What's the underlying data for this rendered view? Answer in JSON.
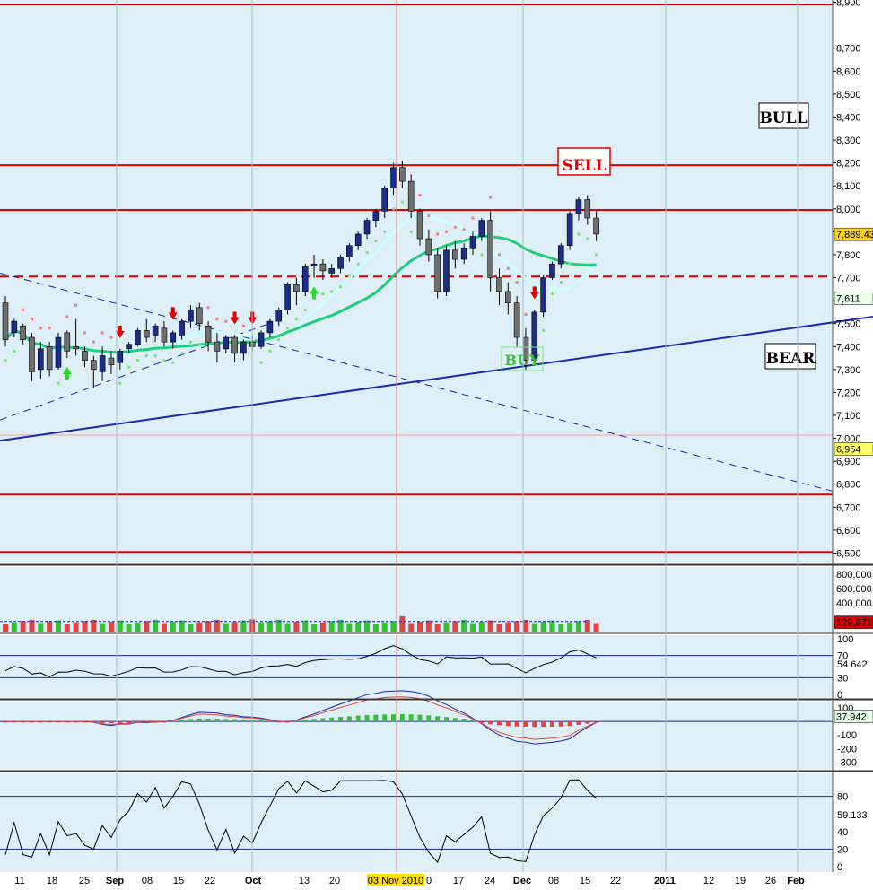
{
  "chart_data": {
    "type": "candlestick",
    "colors": {
      "background": "#dfeff7",
      "grid": "#a9bccb",
      "candle_up": "#1c2c8c",
      "candle_down": "#6f6f6f",
      "ma_green": "#1ecf7a",
      "ma_cyan": "#ccffff",
      "sar_red": "#f08080",
      "sar_green": "#7ee07e",
      "hline": "#e00000",
      "trend": "#1a2aa8",
      "vol_up": "#34c234",
      "vol_down": "#e04444"
    },
    "price_axis": {
      "ticks": [
        "8,900",
        "8,700",
        "8,600",
        "8,500",
        "8,400",
        "8,300",
        "8,200",
        "8,100",
        "8,000",
        "7,900",
        "7,800",
        "7,700",
        "7,600",
        "7,500",
        "7,400",
        "7,300",
        "7,200",
        "7,100",
        "7,000",
        "6,900",
        "6,800",
        "6,700",
        "6,600",
        "6,500"
      ],
      "ylim": [
        6450,
        8900
      ]
    },
    "last_price": "7,889.43",
    "ma_value": "7,611",
    "low_marker": "6,954",
    "horizontal_levels": [
      {
        "value": 8890,
        "style": "solid"
      },
      {
        "value": 8190,
        "style": "solid"
      },
      {
        "value": 7995,
        "style": "solid"
      },
      {
        "value": 7705,
        "style": "dashed"
      },
      {
        "value": 6755,
        "style": "solid"
      },
      {
        "value": 6505,
        "style": "solid"
      }
    ],
    "annotations": {
      "bull": "BULL",
      "bear": "BEAR",
      "sell": "SELL",
      "buy": "BUY"
    },
    "x_ticks": [
      "11",
      "18",
      "25",
      "Sep",
      "08",
      "15",
      "22",
      "Oct",
      "13",
      "20",
      "03 Nov 2010",
      "0",
      "17",
      "24",
      "Dec",
      "08",
      "15",
      "22",
      "2011",
      "12",
      "19",
      "26",
      "Feb"
    ],
    "candles": [
      {
        "o": 7590,
        "h": 7620,
        "c": 7430,
        "l": 7400
      },
      {
        "o": 7460,
        "h": 7520,
        "c": 7510,
        "l": 7440
      },
      {
        "o": 7490,
        "h": 7500,
        "c": 7430,
        "l": 7410
      },
      {
        "o": 7440,
        "h": 7460,
        "c": 7290,
        "l": 7250
      },
      {
        "o": 7300,
        "h": 7420,
        "c": 7390,
        "l": 7260
      },
      {
        "o": 7400,
        "h": 7420,
        "c": 7300,
        "l": 7270
      },
      {
        "o": 7310,
        "h": 7460,
        "c": 7440,
        "l": 7300
      },
      {
        "o": 7460,
        "h": 7470,
        "c": 7380,
        "l": 7350
      },
      {
        "o": 7400,
        "h": 7520,
        "c": 7390,
        "l": 7360
      },
      {
        "o": 7380,
        "h": 7400,
        "c": 7340,
        "l": 7310
      },
      {
        "o": 7340,
        "h": 7360,
        "c": 7300,
        "l": 7220
      },
      {
        "o": 7290,
        "h": 7400,
        "c": 7360,
        "l": 7250
      },
      {
        "o": 7350,
        "h": 7380,
        "c": 7320,
        "l": 7280
      },
      {
        "o": 7330,
        "h": 7390,
        "c": 7380,
        "l": 7300
      },
      {
        "o": 7390,
        "h": 7420,
        "c": 7410,
        "l": 7370
      },
      {
        "o": 7410,
        "h": 7480,
        "c": 7470,
        "l": 7400
      },
      {
        "o": 7470,
        "h": 7520,
        "c": 7440,
        "l": 7420
      },
      {
        "o": 7450,
        "h": 7500,
        "c": 7490,
        "l": 7420
      },
      {
        "o": 7480,
        "h": 7510,
        "c": 7420,
        "l": 7400
      },
      {
        "o": 7420,
        "h": 7470,
        "c": 7460,
        "l": 7390
      },
      {
        "o": 7450,
        "h": 7520,
        "c": 7510,
        "l": 7430
      },
      {
        "o": 7510,
        "h": 7580,
        "c": 7560,
        "l": 7480
      },
      {
        "o": 7570,
        "h": 7590,
        "c": 7500,
        "l": 7470
      },
      {
        "o": 7490,
        "h": 7510,
        "c": 7420,
        "l": 7380
      },
      {
        "o": 7420,
        "h": 7460,
        "c": 7380,
        "l": 7330
      },
      {
        "o": 7390,
        "h": 7450,
        "c": 7440,
        "l": 7370
      },
      {
        "o": 7440,
        "h": 7450,
        "c": 7370,
        "l": 7330
      },
      {
        "o": 7370,
        "h": 7430,
        "c": 7420,
        "l": 7340
      },
      {
        "o": 7420,
        "h": 7450,
        "c": 7400,
        "l": 7380
      },
      {
        "o": 7400,
        "h": 7470,
        "c": 7460,
        "l": 7390
      },
      {
        "o": 7460,
        "h": 7520,
        "c": 7510,
        "l": 7440
      },
      {
        "o": 7510,
        "h": 7570,
        "c": 7560,
        "l": 7490
      },
      {
        "o": 7560,
        "h": 7680,
        "c": 7670,
        "l": 7540
      },
      {
        "o": 7670,
        "h": 7700,
        "c": 7640,
        "l": 7580
      },
      {
        "o": 7640,
        "h": 7760,
        "c": 7750,
        "l": 7620
      },
      {
        "o": 7750,
        "h": 7800,
        "c": 7760,
        "l": 7700
      },
      {
        "o": 7760,
        "h": 7780,
        "c": 7730,
        "l": 7690
      },
      {
        "o": 7720,
        "h": 7760,
        "c": 7740,
        "l": 7700
      },
      {
        "o": 7740,
        "h": 7800,
        "c": 7790,
        "l": 7720
      },
      {
        "o": 7790,
        "h": 7850,
        "c": 7840,
        "l": 7770
      },
      {
        "o": 7840,
        "h": 7900,
        "c": 7890,
        "l": 7820
      },
      {
        "o": 7890,
        "h": 7960,
        "c": 7950,
        "l": 7870
      },
      {
        "o": 7950,
        "h": 8000,
        "c": 7990,
        "l": 7920
      },
      {
        "o": 7990,
        "h": 8100,
        "c": 8090,
        "l": 7960
      },
      {
        "o": 8090,
        "h": 8200,
        "c": 8180,
        "l": 8060
      },
      {
        "o": 8180,
        "h": 8210,
        "c": 8120,
        "l": 8090
      },
      {
        "o": 8120,
        "h": 8150,
        "c": 7990,
        "l": 7960
      },
      {
        "o": 7990,
        "h": 8000,
        "c": 7870,
        "l": 7840
      },
      {
        "o": 7870,
        "h": 7910,
        "c": 7800,
        "l": 7770
      },
      {
        "o": 7800,
        "h": 7830,
        "c": 7640,
        "l": 7610
      },
      {
        "o": 7640,
        "h": 7840,
        "c": 7820,
        "l": 7620
      },
      {
        "o": 7820,
        "h": 7860,
        "c": 7780,
        "l": 7740
      },
      {
        "o": 7780,
        "h": 7850,
        "c": 7830,
        "l": 7760
      },
      {
        "o": 7830,
        "h": 7900,
        "c": 7880,
        "l": 7800
      },
      {
        "o": 7880,
        "h": 7960,
        "c": 7950,
        "l": 7860
      },
      {
        "o": 7950,
        "h": 7990,
        "c": 7700,
        "l": 7640
      },
      {
        "o": 7700,
        "h": 7740,
        "c": 7640,
        "l": 7580
      },
      {
        "o": 7640,
        "h": 7680,
        "c": 7590,
        "l": 7540
      },
      {
        "o": 7590,
        "h": 7620,
        "c": 7440,
        "l": 7400
      },
      {
        "o": 7440,
        "h": 7480,
        "c": 7340,
        "l": 7300
      },
      {
        "o": 7340,
        "h": 7560,
        "c": 7550,
        "l": 7320
      },
      {
        "o": 7550,
        "h": 7710,
        "c": 7700,
        "l": 7530
      },
      {
        "o": 7700,
        "h": 7770,
        "c": 7760,
        "l": 7690
      },
      {
        "o": 7760,
        "h": 7850,
        "c": 7840,
        "l": 7740
      },
      {
        "o": 7840,
        "h": 7990,
        "c": 7980,
        "l": 7820
      },
      {
        "o": 7980,
        "h": 8050,
        "c": 8040,
        "l": 7950
      },
      {
        "o": 8040,
        "h": 8060,
        "c": 7960,
        "l": 7930
      },
      {
        "o": 7960,
        "h": 7990,
        "c": 7890,
        "l": 7860
      }
    ],
    "volume_axis": {
      "ticks": [
        "800,000",
        "600,000",
        "400,000"
      ],
      "last": "129,971"
    },
    "rsi": {
      "ticks": [
        "100",
        "70",
        "54.642",
        "30",
        "0"
      ],
      "last": "54.642"
    },
    "macd": {
      "ticks": [
        "100",
        "37.942",
        "-100",
        "-200",
        "-300"
      ],
      "last": "37.942"
    },
    "stoch": {
      "ticks": [
        "80",
        "59.133",
        "40",
        "20",
        "0"
      ],
      "last": "59.133"
    }
  }
}
